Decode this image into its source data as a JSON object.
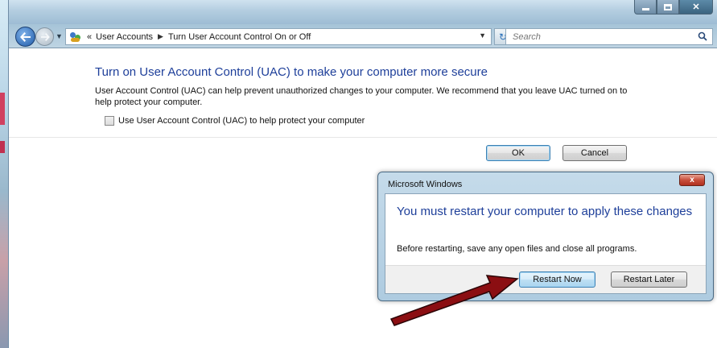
{
  "window": {
    "controls": {
      "minimize": "minimize",
      "maximize": "maximize",
      "close": "close"
    }
  },
  "addressbar": {
    "overflow": "«",
    "breadcrumb": [
      "User Accounts",
      "Turn User Account Control On or Off"
    ],
    "search_placeholder": "Search"
  },
  "main": {
    "heading": "Turn on User Account Control (UAC) to make your computer more secure",
    "description": "User Account Control (UAC) can help prevent unauthorized changes to your computer.  We recommend that you leave UAC turned on to help protect your computer.",
    "checkbox_label": "Use User Account Control (UAC) to help protect your computer",
    "checkbox_checked": false,
    "ok_label": "OK",
    "cancel_label": "Cancel"
  },
  "dialog": {
    "title": "Microsoft Windows",
    "close_glyph": "x",
    "message": "You must restart your computer to apply these changes",
    "detail": "Before restarting, save any open files and close all programs.",
    "restart_now_label": "Restart Now",
    "restart_later_label": "Restart Later"
  },
  "annotation": {
    "arrow_color": "#8b0e12"
  }
}
